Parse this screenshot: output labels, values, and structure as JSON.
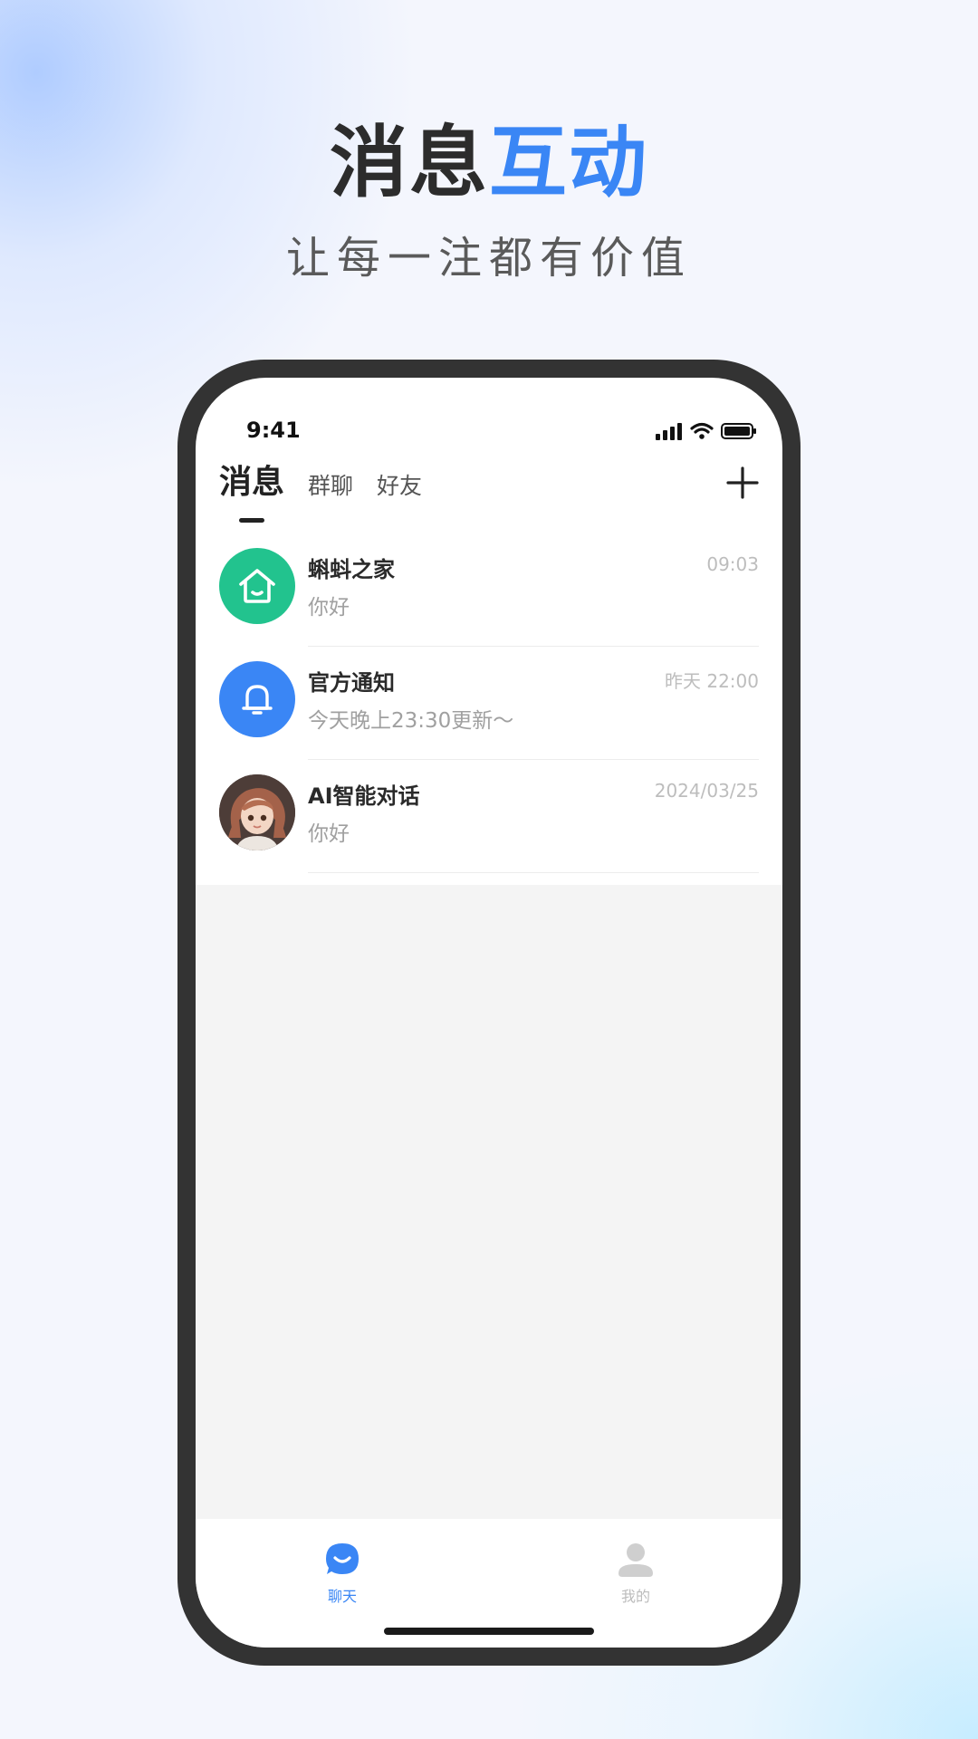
{
  "hero": {
    "title_dark": "消息",
    "title_accent": "互动",
    "subtitle": "让每一注都有价值"
  },
  "status_bar": {
    "time": "9:41",
    "icons": [
      "signal-icon",
      "wifi-icon",
      "battery-icon"
    ]
  },
  "tabs": [
    {
      "label": "消息",
      "active": true
    },
    {
      "label": "群聊",
      "active": false
    },
    {
      "label": "好友",
      "active": false
    }
  ],
  "conversations": [
    {
      "name": "蝌蚪之家",
      "preview": "你好",
      "time": "09:03",
      "avatar": "home-icon",
      "avatar_color": "#22c38e"
    },
    {
      "name": "官方通知",
      "preview": "今天晚上23:30更新～",
      "time": "昨天 22:00",
      "avatar": "bell-icon",
      "avatar_color": "#3a86f5"
    },
    {
      "name": "AI智能对话",
      "preview": "你好",
      "time": "2024/03/25",
      "avatar": "ai-girl-avatar",
      "avatar_color": "#5a4a44"
    }
  ],
  "bottom_nav": [
    {
      "label": "聊天",
      "icon": "chat-icon",
      "active": true
    },
    {
      "label": "我的",
      "icon": "profile-icon",
      "active": false
    }
  ],
  "colors": {
    "accent": "#3a86f5",
    "green": "#22c38e",
    "phone_frame": "#333333"
  }
}
